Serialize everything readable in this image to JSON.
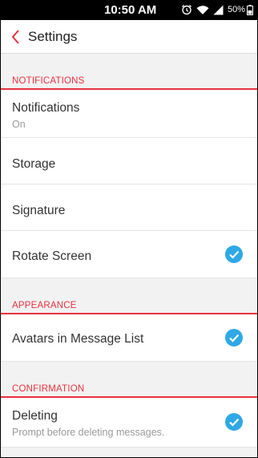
{
  "status_bar": {
    "time": "10:50 AM",
    "battery": "50%",
    "icons": [
      "alarm-icon",
      "wifi-icon",
      "signal-icon",
      "battery-icon"
    ]
  },
  "app_bar": {
    "back_icon": "chevron-left-icon",
    "title": "Settings"
  },
  "sections": [
    {
      "header": "NOTIFICATIONS",
      "items": [
        {
          "title": "Notifications",
          "subtitle": "On",
          "checked": false
        },
        {
          "title": "Storage",
          "checked": false
        },
        {
          "title": "Signature",
          "checked": false
        },
        {
          "title": "Rotate Screen",
          "checked": true
        }
      ]
    },
    {
      "header": "APPEARANCE",
      "items": [
        {
          "title": "Avatars in Message List",
          "checked": true
        }
      ]
    },
    {
      "header": "CONFIRMATION",
      "items": [
        {
          "title": "Deleting",
          "subtitle": "Prompt before deleting messages.",
          "checked": true
        }
      ]
    }
  ],
  "colors": {
    "accent": "#e8313f",
    "checkbox": "#2ea8e6",
    "background": "#f2f2f2"
  }
}
